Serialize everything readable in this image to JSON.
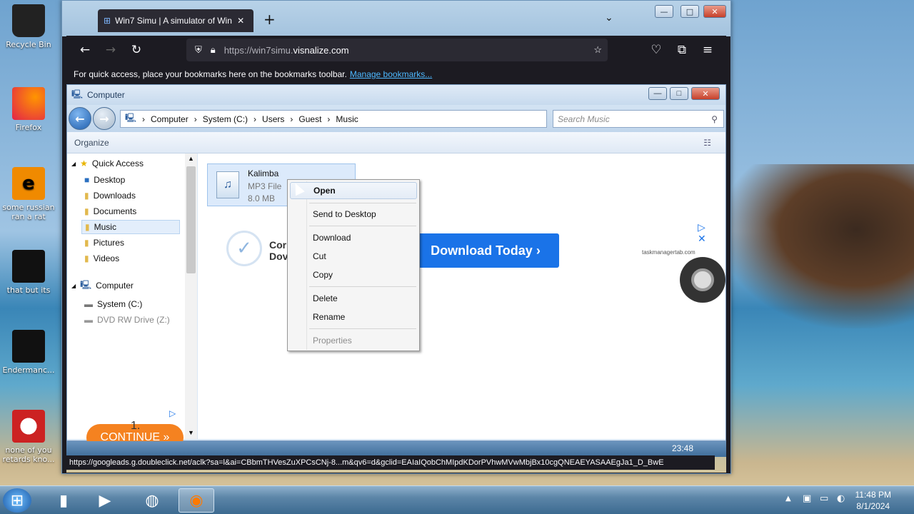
{
  "desktop": {
    "icons": [
      {
        "label": "Recycle Bin",
        "icon": "recycle-bin-icon"
      },
      {
        "label": "Firefox",
        "icon": "firefox-icon"
      },
      {
        "label": "some russian ran a rat",
        "icon": "ie-icon"
      },
      {
        "label": "that but its",
        "icon": "shortcut-icon"
      },
      {
        "label": "Endermanc...",
        "icon": "app-icon"
      },
      {
        "label": "none of you retards kno...",
        "icon": "app-icon"
      }
    ]
  },
  "browser": {
    "tab_title": "Win7 Simu | A simulator of Win",
    "url_prefix": "https://win7simu.",
    "url_host": "visnalize.com",
    "bookmarks_text": "For quick access, place your bookmarks here on the bookmarks toolbar.",
    "bookmarks_link": "Manage bookmarks...",
    "status_url": "https://googleads.g.doubleclick.net/aclk?sa=l&ai=CBbmTHVesZuXPCsCNj-8...m&qv6=d&gclid=EAIaIQobChMIpdKDorPVhwMVwMbjBx10cgQNEAEYASAAEgJa1_D_BwE"
  },
  "explorer": {
    "title": "Computer",
    "breadcrumb": [
      "Computer",
      "System (C:)",
      "Users",
      "Guest",
      "Music"
    ],
    "search_placeholder": "Search Music",
    "organize": "Organize",
    "sidebar": {
      "quick_access": "Quick Access",
      "items": [
        "Desktop",
        "Downloads",
        "Documents",
        "Music",
        "Pictures",
        "Videos"
      ],
      "computer": "Computer",
      "drives": [
        "System (C:)",
        "DVD RW Drive (Z:)"
      ]
    },
    "file": {
      "name": "Kalimba",
      "type": "MP3 File",
      "size": "8.0 MB"
    }
  },
  "context_menu": {
    "items": [
      "Open",
      "Send to Desktop",
      "Download",
      "Cut",
      "Copy",
      "Delete",
      "Rename",
      "Properties"
    ]
  },
  "ads": {
    "ad1_text_line1": "Cor",
    "ad1_text_line2": "Dov",
    "ad1_button": "Download Today ›",
    "ad1_site": "taskmanagertab.com",
    "ad2_button": "CONTINUE »",
    "page_number": "1."
  },
  "inner_taskbar": {
    "time": "23:48"
  },
  "taskbar": {
    "time": "11:48 PM",
    "date": "8/1/2024"
  }
}
